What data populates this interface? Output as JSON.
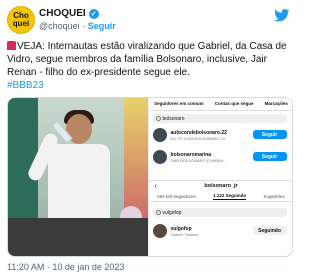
{
  "account": {
    "name": "CHOQUEI",
    "handle": "@choquei",
    "separator": "·",
    "follow_label": "Seguir",
    "avatar_line1": "Cho",
    "avatar_line2": "quei"
  },
  "tweet": {
    "text": "VEJA: Internautas estão viralizando que Gabriel, da Casa de Vidro, segue membros da família Bolsonaro, inclusive, Jair Renan - filho do ex-presidente segue ele.",
    "hashtag": "#BBB23",
    "timestamp": "11:20 AM · 10 de jan de 2023"
  },
  "screenshot": {
    "tabs": [
      "Seguidores em comum",
      "Contas que segue",
      "Marcações"
    ],
    "search1": "bolsonaro",
    "row1_name": "autocondebolsonaro.22",
    "row1_sub": "EU TÔ COM BOLSONARO 22",
    "row1_button": "Seguir",
    "row2_name": "bolsonaromarina",
    "row2_sub": "JAIR BOLSONARO E MARIA...",
    "row2_button": "Seguir",
    "profile_name": "bolsonaro_jr",
    "ptab1": "692 Mil Seguidores",
    "ptab2": "1.122 Seguindo",
    "ptab3": "Sugestões",
    "search2": "vulgofop",
    "row3_name": "vulgofop",
    "row3_sub": "Gabriel Tavares",
    "row3_button": "Seguindo"
  },
  "colors": {
    "link": "#1d9bf0",
    "brand_avatar": "#f5c400"
  }
}
